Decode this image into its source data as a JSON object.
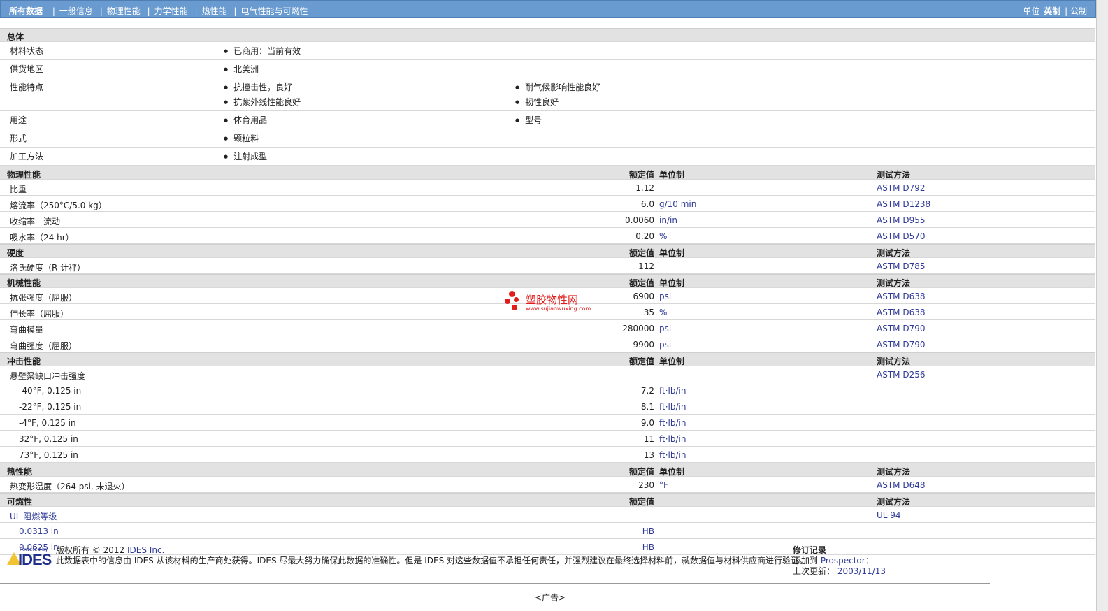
{
  "nav": {
    "active": "所有数据",
    "links": [
      "一般信息",
      "物理性能",
      "力学性能",
      "热性能",
      "电气性能与可燃性"
    ],
    "units_label": "单位",
    "units_active": "英制",
    "units_other": "公制"
  },
  "general": {
    "title": "总体",
    "rows": [
      {
        "label": "材料状态",
        "values": [
          "已商用：当前有效"
        ]
      },
      {
        "label": "供货地区",
        "values": [
          "北美洲"
        ]
      },
      {
        "label": "性能特点",
        "values": [
          "抗撞击性，良好",
          "耐气候影响性能良好",
          "抗紫外线性能良好",
          "韧性良好"
        ]
      },
      {
        "label": "用途",
        "values": [
          "体育用品",
          "型号"
        ]
      },
      {
        "label": "形式",
        "values": [
          "颗粒料"
        ]
      },
      {
        "label": "加工方法",
        "values": [
          "注射成型"
        ]
      }
    ]
  },
  "headers": {
    "value": "额定值",
    "unit": "单位制",
    "method": "测试方法"
  },
  "physical": {
    "title": "物理性能",
    "rows": [
      {
        "label": "比重",
        "value": "1.12",
        "unit": "",
        "method": "ASTM D792"
      },
      {
        "label": "熔流率（250°C/5.0 kg）",
        "value": "6.0",
        "unit": "g/10 min",
        "method": "ASTM D1238"
      },
      {
        "label": "收缩率 - 流动",
        "value": "0.0060",
        "unit": "in/in",
        "method": "ASTM D955"
      },
      {
        "label": "吸水率（24 hr）",
        "value": "0.20",
        "unit": "%",
        "method": "ASTM D570"
      }
    ]
  },
  "hardness": {
    "title": "硬度",
    "rows": [
      {
        "label": "洛氏硬度（R 计秤）",
        "value": "112",
        "unit": "",
        "method": "ASTM D785"
      }
    ]
  },
  "mechanical": {
    "title": "机械性能",
    "rows": [
      {
        "label": "抗张强度（屈服）",
        "value": "6900",
        "unit": "psi",
        "method": "ASTM D638"
      },
      {
        "label": "伸长率（屈服）",
        "value": "35",
        "unit": "%",
        "method": "ASTM D638"
      },
      {
        "label": "弯曲模量",
        "value": "280000",
        "unit": "psi",
        "method": "ASTM D790"
      },
      {
        "label": "弯曲强度（屈服）",
        "value": "9900",
        "unit": "psi",
        "method": "ASTM D790"
      }
    ]
  },
  "impact": {
    "title": "冲击性能",
    "parent": {
      "label": "悬壁梁缺口冲击强度",
      "method": "ASTM D256"
    },
    "rows": [
      {
        "label": "-40°F, 0.125 in",
        "value": "7.2",
        "unit": "ft·lb/in"
      },
      {
        "label": "-22°F, 0.125 in",
        "value": "8.1",
        "unit": "ft·lb/in"
      },
      {
        "label": "-4°F, 0.125 in",
        "value": "9.0",
        "unit": "ft·lb/in"
      },
      {
        "label": "32°F, 0.125 in",
        "value": "11",
        "unit": "ft·lb/in"
      },
      {
        "label": "73°F, 0.125 in",
        "value": "13",
        "unit": "ft·lb/in"
      }
    ]
  },
  "thermal": {
    "title": "热性能",
    "rows": [
      {
        "label": "热变形温度（264 psi, 未退火）",
        "value": "230",
        "unit": "°F",
        "method": "ASTM D648"
      }
    ]
  },
  "flammability": {
    "title": "可燃性",
    "parent": {
      "label": "UL 阻燃等级",
      "method": "UL 94"
    },
    "rows": [
      {
        "label": "0.0313 in",
        "value": "HB"
      },
      {
        "label": "0.0625 in",
        "value": "HB"
      }
    ]
  },
  "watermark": {
    "text": "塑胶物性网",
    "url": "www.sujiaowuxing.com",
    "color": "#e21b1b"
  },
  "footer": {
    "logo_small": "Powered by",
    "logo_big": "IDES",
    "copyright": "版权所有 © 2012",
    "company_link": "IDES Inc.",
    "disclaimer": "此数据表中的信息由 IDES 从该材料的生产商处获得。IDES 尽最大努力确保此数据的准确性。但是 IDES 对这些数据值不承担任何责任，并强烈建议在最终选择材料前，就数据值与材料供应商进行验证。",
    "rev_title": "修订记录",
    "added_to_label": "添加到",
    "added_to_link": "Prospector：",
    "last_updated_label": "上次更新：",
    "last_updated": "2003/11/13"
  },
  "ad": "<广告>"
}
